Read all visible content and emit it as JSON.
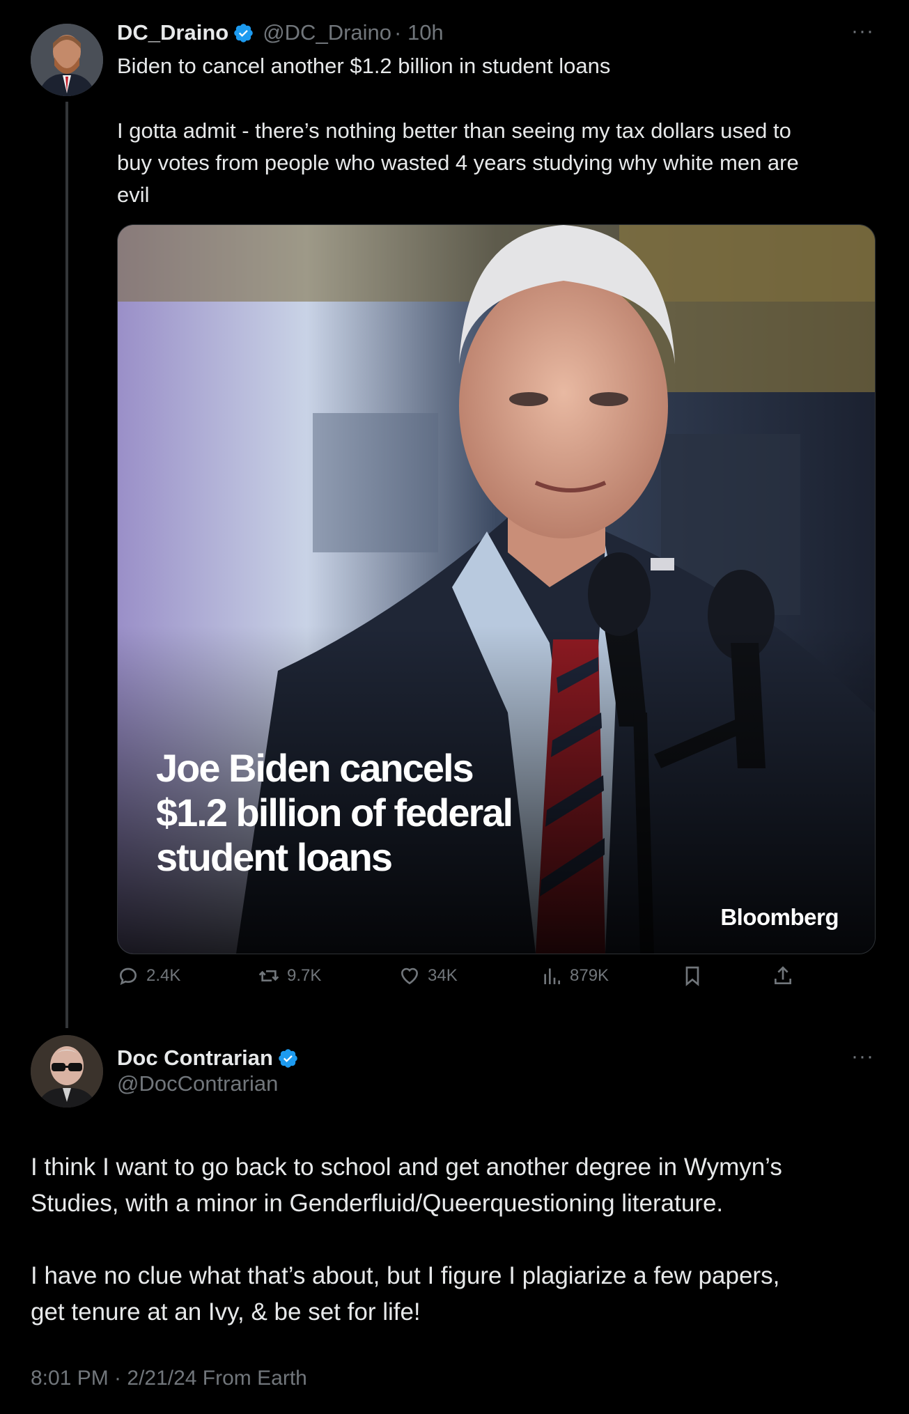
{
  "tweet1": {
    "name": "DC_Draino",
    "handle": "@DC_Draino",
    "time": "· 10h",
    "more": "···",
    "text_line1": "Biden to cancel another $1.2 billion in student loans",
    "text_body": "I gotta admit - there’s nothing better than seeing my tax dollars used to\nbuy votes from people who wasted 4 years studying why white men are\nevil",
    "media": {
      "headline": "Joe Biden cancels\n$1.2 billion of federal\nstudent loans",
      "brand": "Bloomberg"
    },
    "stats": {
      "replies": "2.4K",
      "reposts": "9.7K",
      "likes": "34K",
      "views": "879K"
    }
  },
  "tweet2": {
    "name": "Doc Contrarian",
    "handle": "@DocContrarian",
    "more": "···",
    "text": "I think I want to go back to school and get another degree in Wymyn’s\nStudies, with a minor in Genderfluid/Queerquestioning literature.\n\nI have no clue what that’s about, but I figure I plagiarize a few papers,\nget tenure at an Ivy, & be set for life!",
    "meta": "8:01 PM · 2/21/24 From Earth"
  },
  "colors": {
    "background": "#000000",
    "text": "#e7e9ea",
    "muted": "#71767b",
    "verified": "#1d9bf0"
  }
}
